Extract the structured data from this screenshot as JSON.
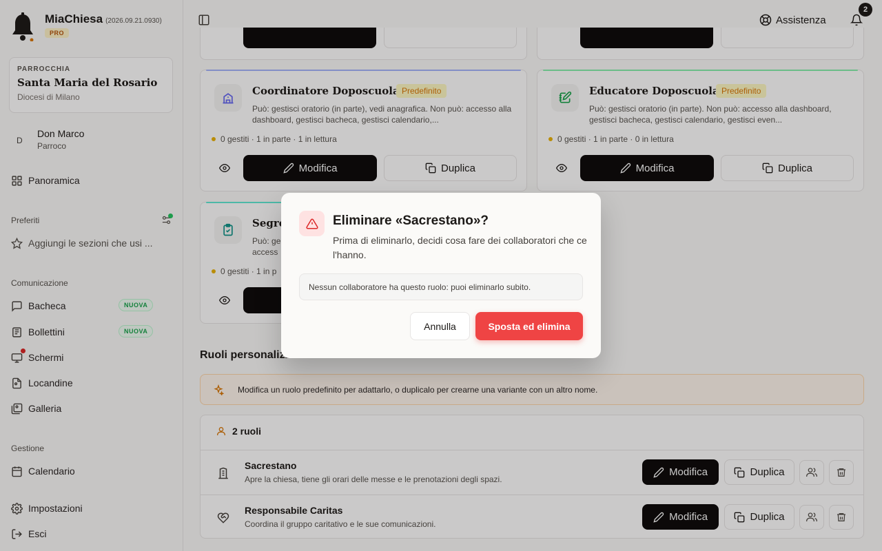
{
  "app": {
    "name": "MiaChiesa",
    "version": "(2026.09.21.0930)",
    "plan_badge": "PRO"
  },
  "parish": {
    "label": "PARROCCHIA",
    "name": "Santa Maria del Rosario",
    "diocese": "Diocesi di Milano"
  },
  "user": {
    "initial": "D",
    "name": "Don Marco",
    "role": "Parroco"
  },
  "sidebar": {
    "overview": "Panoramica",
    "favorites_section": "Preferiti",
    "favorites_hint": "Aggiungi le sezioni che usi ...",
    "communication_section": "Comunicazione",
    "communication_items": [
      {
        "label": "Bacheca",
        "badge": "NUOVA"
      },
      {
        "label": "Bollettini",
        "badge": "NUOVA"
      },
      {
        "label": "Schermi"
      },
      {
        "label": "Locandine"
      },
      {
        "label": "Galleria"
      }
    ],
    "management_section": "Gestione",
    "calendar": "Calendario",
    "settings": "Impostazioni",
    "logout": "Esci"
  },
  "topbar": {
    "help_label": "Assistenza",
    "notifications_count": "2"
  },
  "role_cards": [
    {
      "title": "Coordinatore Doposcuola",
      "badge": "Predefinito",
      "description": "Può: gestisci oratorio (in parte), vedi anagrafica. Non può: accesso alla dashboard, gestisci bacheca, gestisci calendario,...",
      "stats": "0 gestiti · 1 in parte · 1 in lettura",
      "edit_label": "Modifica",
      "duplicate_label": "Duplica"
    },
    {
      "title": "Educatore Doposcuola",
      "badge": "Predefinito",
      "description": "Può: gestisci oratorio (in parte). Non può: accesso alla dashboard, gestisci bacheca, gestisci calendario, gestisci even...",
      "stats": "0 gestiti · 1 in parte · 0 in lettura",
      "edit_label": "Modifica",
      "duplicate_label": "Duplica"
    },
    {
      "title": "Segre",
      "description": "Può: ge\naccess",
      "stats": "0 gestiti · 1 in p"
    }
  ],
  "custom_roles": {
    "title": "Ruoli personalizzati",
    "info": "Modifica un ruolo predefinito per adattarlo, o duplicalo per crearne una variante con un altro nome.",
    "count_label": "2 ruoli",
    "rows": [
      {
        "name": "Sacrestano",
        "description": "Apre la chiesa, tiene gli orari delle messe e le prenotazioni degli spazi.",
        "edit_label": "Modifica",
        "duplicate_label": "Duplica"
      },
      {
        "name": "Responsabile Caritas",
        "description": "Coordina il gruppo caritativo e le sue comunicazioni.",
        "edit_label": "Modifica",
        "duplicate_label": "Duplica"
      }
    ]
  },
  "modal": {
    "title": "Eliminare «Sacrestano»?",
    "text": "Prima di eliminarlo, decidi cosa fare dei collaboratori che ce l'hanno.",
    "note": "Nessun collaboratore ha questo ruolo: puoi eliminarlo subito.",
    "cancel_label": "Annulla",
    "confirm_label": "Sposta ed elimina"
  },
  "colors": {
    "danger": "#ef4444",
    "primary": "#0c0a09",
    "badge_green": "#16a34a",
    "badge_amber": "#d97706"
  }
}
